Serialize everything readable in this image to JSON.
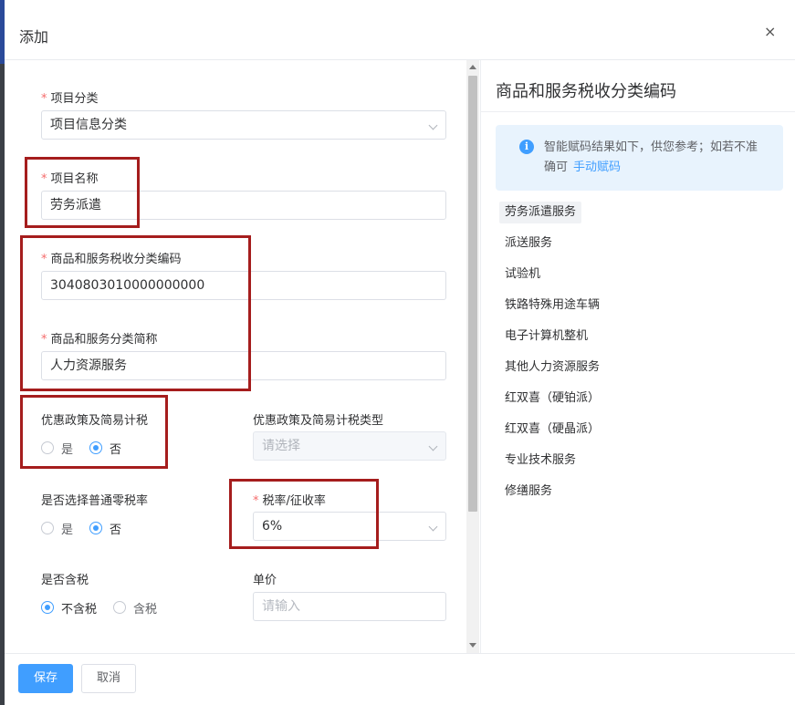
{
  "dialog": {
    "title": "添加",
    "close_symbol": "×"
  },
  "form": {
    "project_category": {
      "label": "项目分类",
      "value": "项目信息分类"
    },
    "project_name": {
      "label": "项目名称",
      "value": "劳务派遣"
    },
    "tax_code": {
      "label": "商品和服务税收分类编码",
      "value": "3040803010000000000"
    },
    "tax_short_name": {
      "label": "商品和服务分类简称",
      "value": "人力资源服务"
    },
    "preferential_policy": {
      "label": "优惠政策及简易计税",
      "options": [
        "是",
        "否"
      ],
      "selected": "否"
    },
    "policy_type": {
      "label": "优惠政策及简易计税类型",
      "placeholder": "请选择"
    },
    "zero_rate": {
      "label": "是否选择普通零税率",
      "options": [
        "是",
        "否"
      ],
      "selected": "否"
    },
    "tax_rate": {
      "label": "税率/征收率",
      "value": "6%"
    },
    "tax_included": {
      "label": "是否含税",
      "options": [
        "不含税",
        "含税"
      ],
      "selected": "不含税"
    },
    "unit_price": {
      "label": "单价",
      "placeholder": "请输入"
    }
  },
  "side_panel": {
    "title": "商品和服务税收分类编码",
    "notice_text": "智能赋码结果如下，供您参考；如若不准确可",
    "notice_link": "手动赋码",
    "items": [
      "劳务派遣服务",
      "派送服务",
      "试验机",
      "铁路特殊用途车辆",
      "电子计算机整机",
      "其他人力资源服务",
      "红双喜（硬铂派）",
      "红双喜（硬晶派）",
      "专业技术服务",
      "修缮服务"
    ]
  },
  "footer": {
    "save_label": "保存",
    "cancel_label": "取消"
  },
  "colors": {
    "primary": "#409eff",
    "highlight": "#a51d1d",
    "required_star": "#f56c6c",
    "notice_bg": "#e8f3fd"
  }
}
